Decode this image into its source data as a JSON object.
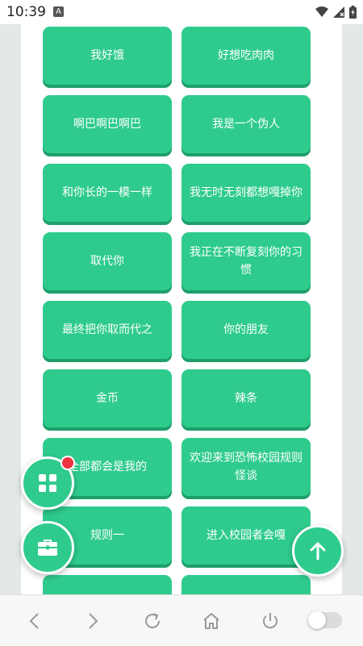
{
  "status_bar": {
    "time": "10:39",
    "notification_icon": "A"
  },
  "tiles": [
    {
      "label": "我好饿"
    },
    {
      "label": "好想吃肉肉"
    },
    {
      "label": "啊巴啊巴啊巴"
    },
    {
      "label": "我是一个伪人"
    },
    {
      "label": "和你长的一模一样"
    },
    {
      "label": "我无时无刻都想嘎掉你"
    },
    {
      "label": "取代你"
    },
    {
      "label": "我正在不断复刻你的习惯"
    },
    {
      "label": "最终把你取而代之"
    },
    {
      "label": "你的朋友"
    },
    {
      "label": "金币"
    },
    {
      "label": "辣条"
    },
    {
      "label": "全部都会是我的"
    },
    {
      "label": "欢迎来到恐怖校园规则怪谈"
    },
    {
      "label": "规则一"
    },
    {
      "label": "进入校园者会嘎"
    },
    {
      "label": ""
    },
    {
      "label": ""
    }
  ],
  "icons": {
    "grid": "grid-icon",
    "toolbox": "toolbox-icon",
    "scroll_top": "arrow-up-icon",
    "back": "chevron-left-icon",
    "forward": "chevron-right-icon",
    "refresh": "refresh-icon",
    "home": "home-icon",
    "power": "power-icon"
  },
  "colors": {
    "tile": "#2ecb8d",
    "tile_shadow": "#1e9f6c",
    "badge": "#ef3340"
  }
}
